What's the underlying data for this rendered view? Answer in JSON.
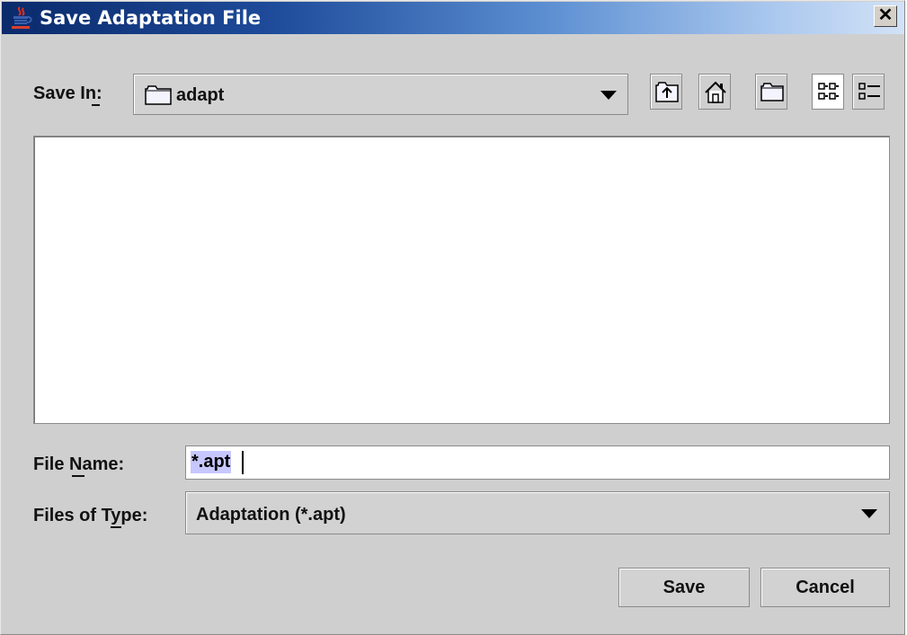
{
  "window": {
    "title": "Save Adaptation File",
    "close_glyph": "✕"
  },
  "save_in": {
    "label": "Save In:",
    "mnemonic_char": "I",
    "value": "adapt",
    "icon": "folder-icon"
  },
  "toolbar": {
    "buttons": [
      {
        "name": "up-one-level-button",
        "icon": "folder-up-icon"
      },
      {
        "name": "home-button",
        "icon": "home-icon"
      },
      {
        "name": "new-folder-button",
        "icon": "new-folder-icon"
      },
      {
        "name": "list-view-button",
        "icon": "list-view-icon",
        "pressed": true
      },
      {
        "name": "details-view-button",
        "icon": "details-view-icon",
        "pressed": false
      }
    ]
  },
  "file_name": {
    "label": "File Name:",
    "mnemonic_char": "N",
    "value": "*.apt"
  },
  "files_of_type": {
    "label": "Files of Type:",
    "mnemonic_char": "T",
    "value": "Adaptation (*.apt)"
  },
  "actions": {
    "save_label": "Save",
    "cancel_label": "Cancel"
  },
  "colors": {
    "title_gradient_start": "#0a2a6b",
    "title_gradient_end": "#d2e2f7",
    "dialog_bg": "#cfcfcf",
    "selection": "#c7c7ff"
  }
}
